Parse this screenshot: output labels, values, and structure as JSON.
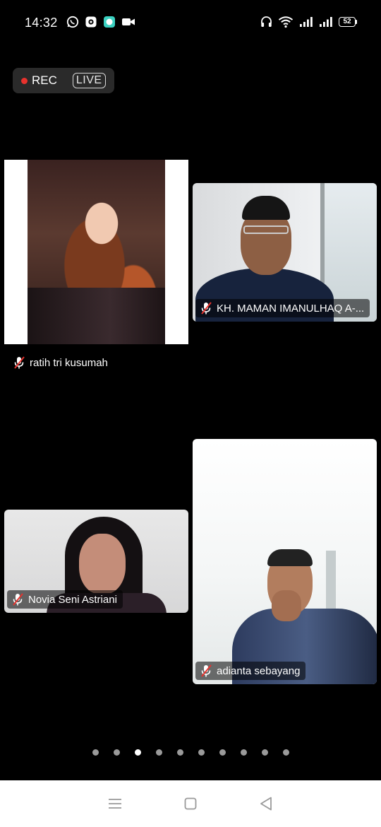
{
  "status_bar": {
    "time": "14:32",
    "icons_left": [
      "whatsapp-icon",
      "camera-app-icon",
      "chat-app-icon",
      "video-camera-icon"
    ],
    "icons_right": [
      "headset-icon",
      "wifi-icon",
      "signal-icon",
      "signal-icon"
    ],
    "battery": "52"
  },
  "recording": {
    "rec_label": "REC",
    "live_label": "LIVE",
    "rec_color": "#e8322d"
  },
  "participants": [
    {
      "name": "ratih tri kusumah",
      "muted": true
    },
    {
      "name": "KH. MAMAN IMANULHAQ A-...",
      "muted": true
    },
    {
      "name": "Novia Seni Astriani",
      "muted": true
    },
    {
      "name": "adianta sebayang",
      "muted": true
    }
  ],
  "pagination": {
    "total_pages": 10,
    "current_page": 3
  },
  "nav_bar": {
    "buttons": [
      "menu-icon",
      "home-icon",
      "back-icon"
    ]
  }
}
